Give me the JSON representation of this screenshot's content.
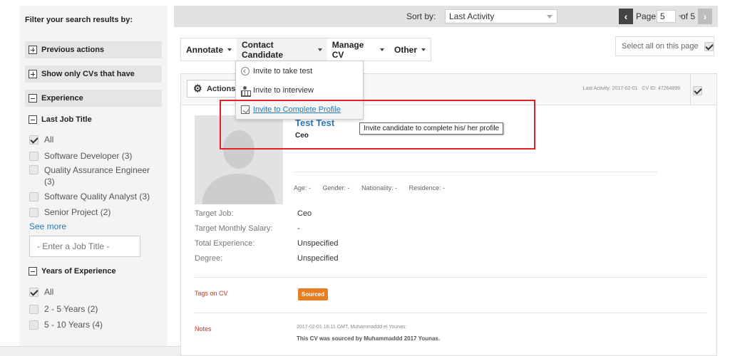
{
  "sidebar": {
    "filter_heading": "Filter your search results by:",
    "sections": {
      "previous_actions": "Previous actions",
      "show_only": "Show only CVs that have",
      "experience": "Experience"
    },
    "last_job_title": {
      "heading": "Last Job Title",
      "options": [
        {
          "label": "All",
          "checked": true
        },
        {
          "label": "Software Developer (3)",
          "checked": false
        },
        {
          "label": "Quality Assurance Engineer (3)",
          "checked": false
        },
        {
          "label": "Software Quality Analyst (3)",
          "checked": false
        },
        {
          "label": "Senior Project (2)",
          "checked": false
        }
      ],
      "see_more": "See more",
      "input_placeholder": "- Enter a Job Title -"
    },
    "years_of_experience": {
      "heading": "Years of Experience",
      "options": [
        {
          "label": "All",
          "checked": true
        },
        {
          "label": "2 - 5 Years (2)",
          "checked": false
        },
        {
          "label": "5 - 10 Years (4)",
          "checked": false
        }
      ]
    }
  },
  "sortbar": {
    "sort_label": "Sort by:",
    "sort_value": "Last Activity",
    "page_label": "Page",
    "page_value": "5",
    "page_of": "of 5",
    "prev_icon": "chevron-left-icon",
    "next_icon": "chevron-right-icon"
  },
  "toolbar": {
    "annotate": "Annotate",
    "contact": "Contact Candidate",
    "manage": "Manage CV",
    "other": "Other",
    "select_all": "Select all on this page"
  },
  "dropdown": {
    "items": [
      {
        "label": "Invite to take test",
        "icon": "test-icon"
      },
      {
        "label": "Invite to interview",
        "icon": "interview-icon"
      },
      {
        "label": "Invite to Complete Profile",
        "icon": "profile-edit-icon"
      }
    ]
  },
  "tooltip": "Invite candidate to complete his/ her profile",
  "candidate": {
    "actions": "Actions",
    "last_activity": "Last Activity: 2017-02-01",
    "cv_id": "CV ID: 47264899",
    "name": "Test Test",
    "title": "Ceo",
    "meta": {
      "age": "Age: -",
      "gender": "Gender: -",
      "nationality": "Nationality: -",
      "residence": "Residence: -"
    },
    "details": [
      {
        "key": "Target Job:",
        "value": "Ceo"
      },
      {
        "key": "Target Monthly Salary:",
        "value": "-"
      },
      {
        "key": "Total Experience:",
        "value": "Unspecified"
      },
      {
        "key": "Degree:",
        "value": "Unspecified"
      }
    ],
    "tags_label": "Tags on CV",
    "tag": "Sourced",
    "notes_label": "Notes",
    "note_meta": "2017-02-01 16:11 GMT, Muhammaddd el Younas:",
    "note_text": "This CV was sourced by Muhammaddd 2017 Younas."
  },
  "colors": {
    "accent": "#2a7ab8",
    "highlight_box": "#e32128",
    "tag": "#e67e22"
  }
}
